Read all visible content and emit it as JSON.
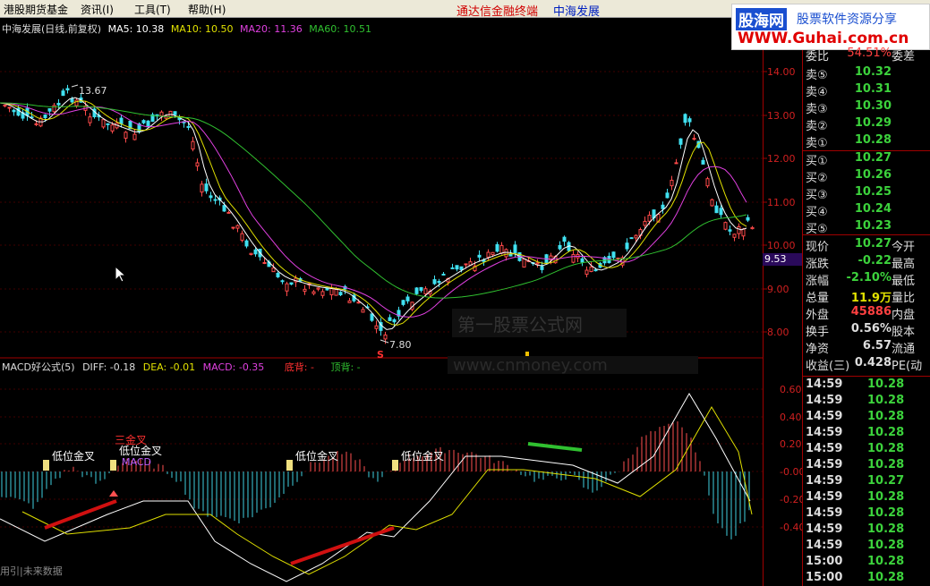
{
  "menu": {
    "items": [
      {
        "label": "港股期货基金"
      },
      {
        "label": "资讯(I)"
      },
      {
        "label": "工具(T)"
      },
      {
        "label": "帮助(H)"
      }
    ],
    "app_title": "通达信金融终端",
    "stock_title": "中海发展"
  },
  "logo": {
    "main": "股海网",
    "sub": "股票软件资源分享",
    "url": "WWW.Guhai.com.cn"
  },
  "main_legend": {
    "name": "中海发展(日线,前复权)",
    "ma5": "MA5: 10.38",
    "ma10": "MA10: 10.50",
    "ma20": "MA20: 11.36",
    "ma60": "MA60: 10.51",
    "colors": {
      "ma5": "#ffffff",
      "ma10": "#e0e000",
      "ma20": "#e040e0",
      "ma60": "#30c030"
    }
  },
  "macd_legend": {
    "name": "MACD好公式(5)",
    "diff": "DIFF: -0.18",
    "dea": "DEA: -0.01",
    "macd": "MACD: -0.35",
    "bottom": "底背: -",
    "top": "顶背: -"
  },
  "price_axis": [
    "14.00",
    "13.00",
    "12.00",
    "11.00",
    "10.00",
    "9.00",
    "8.00"
  ],
  "price_tag": "9.53",
  "macd_axis": [
    "0.60",
    "0.40",
    "0.20",
    "-0.00",
    "-0.20",
    "-0.40"
  ],
  "annotations": {
    "high": "13.67",
    "low": "7.80",
    "signal_s": "S",
    "labels": [
      {
        "text": "低位金叉"
      },
      {
        "text": "三金叉"
      },
      {
        "text": "低位金叉"
      },
      {
        "text": "低位金叉"
      },
      {
        "text": "低位金叉"
      }
    ],
    "macd_tag": "MACD"
  },
  "watermarks": {
    "cn": "第一股票公式网",
    "url": "www.cnmoney.com"
  },
  "bottom_text": "用引|未来数据",
  "quote": {
    "header_label": "委比",
    "header_value": "54.51%",
    "header_label2": "委差",
    "asks": [
      {
        "label": "卖⑤",
        "price": "10.32"
      },
      {
        "label": "卖④",
        "price": "10.31"
      },
      {
        "label": "卖③",
        "price": "10.30"
      },
      {
        "label": "卖②",
        "price": "10.29"
      },
      {
        "label": "卖①",
        "price": "10.28"
      }
    ],
    "bids": [
      {
        "label": "买①",
        "price": "10.27"
      },
      {
        "label": "买②",
        "price": "10.26"
      },
      {
        "label": "买③",
        "price": "10.25"
      },
      {
        "label": "买④",
        "price": "10.24"
      },
      {
        "label": "买⑤",
        "price": "10.23"
      }
    ],
    "stats": [
      {
        "label": "现价",
        "value": "10.27",
        "label2": "今开",
        "color": "#3cd23c"
      },
      {
        "label": "涨跌",
        "value": "-0.22",
        "label2": "最高",
        "color": "#3cd23c"
      },
      {
        "label": "涨幅",
        "value": "-2.10%",
        "label2": "最低",
        "color": "#3cd23c"
      },
      {
        "label": "总量",
        "value": "11.9万",
        "label2": "量比",
        "color": "#e0e000"
      },
      {
        "label": "外盘",
        "value": "45886",
        "label2": "内盘",
        "color": "#ff4040"
      },
      {
        "label": "换手",
        "value": "0.56%",
        "label2": "股本",
        "color": "#dddddd"
      },
      {
        "label": "净资",
        "value": "6.57",
        "label2": "流通",
        "color": "#dddddd"
      },
      {
        "label": "收益(三)",
        "value": "0.428",
        "label2": "PE(动",
        "color": "#dddddd"
      }
    ],
    "ticks": [
      {
        "time": "14:59",
        "price": "10.28"
      },
      {
        "time": "14:59",
        "price": "10.28"
      },
      {
        "time": "14:59",
        "price": "10.28"
      },
      {
        "time": "14:59",
        "price": "10.28"
      },
      {
        "time": "14:59",
        "price": "10.28"
      },
      {
        "time": "14:59",
        "price": "10.28"
      },
      {
        "time": "14:59",
        "price": "10.27"
      },
      {
        "time": "14:59",
        "price": "10.28"
      },
      {
        "time": "14:59",
        "price": "10.28"
      },
      {
        "time": "14:59",
        "price": "10.28"
      },
      {
        "time": "14:59",
        "price": "10.28"
      },
      {
        "time": "15:00",
        "price": "10.28"
      },
      {
        "time": "15:00",
        "price": "10.28"
      }
    ]
  }
}
